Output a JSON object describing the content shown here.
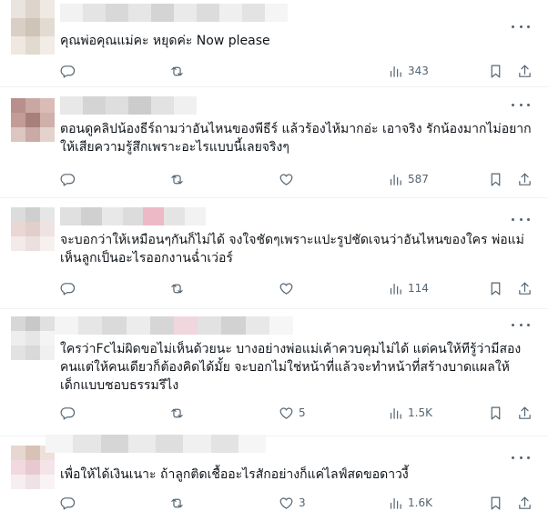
{
  "replies": [
    {
      "text": "คุณพ่อคุณแม่คะ หยุดค่ะ Now please",
      "likes": "",
      "views": "343"
    },
    {
      "text": "ตอนดูคลิปน้องธีร์ถามว่าอันไหนของพีธีร์ แล้วร้องไห้มากอ่ะ เอาจริง รักน้องมากไม่อยาก\nให้เสียความรู้สึกเพราะอะไรแบบนี้เลยจริงๆ",
      "likes": "",
      "views": "587"
    },
    {
      "text": "จะบอกว่าให้เหมือนๆกันก็ไม่ได้ จงใจชัดๆเพราะแปะรูปชัดเจนว่าอันไหนของใคร พ่อแม่\nเห็นลูกเป็นอะไรออกงานฉ่ำเว่อร์",
      "likes": "",
      "views": "114"
    },
    {
      "text": "ใครว่าFcไม่ผิดขอไม่เห็นด้วยนะ บางอย่างพ่อแม่เค้าควบคุมไม่ได้ แต่คนให้ทีรู้ว่ามีสอง\nคนแต่ให้คนเดียวก็ต้องคิดได้มั้ย จะบอกไม่ใช่หน้าที่แล้วจะทำหน้าที่สร้างบาดแผลให้\nเด็กแบบชอบธรรมรึไง",
      "likes": "5",
      "views": "1.5K"
    },
    {
      "text": "เพื่อให้ได้เงินเนาะ ถ้าลูกติดเชื้ออะไรสักอย่างก็แค่ไลฟ์สดขอดาวงี้",
      "likes": "3",
      "views": "1.6K"
    }
  ],
  "icons": {
    "reply": "reply-icon",
    "retweet": "retweet-icon",
    "like": "heart-icon",
    "views": "views-chart-icon",
    "bookmark": "bookmark-icon",
    "share": "share-icon",
    "more": "more-dots-icon"
  },
  "colors": {
    "text": "#0f1419",
    "secondary": "#536471",
    "divider": "#eff3f4"
  }
}
